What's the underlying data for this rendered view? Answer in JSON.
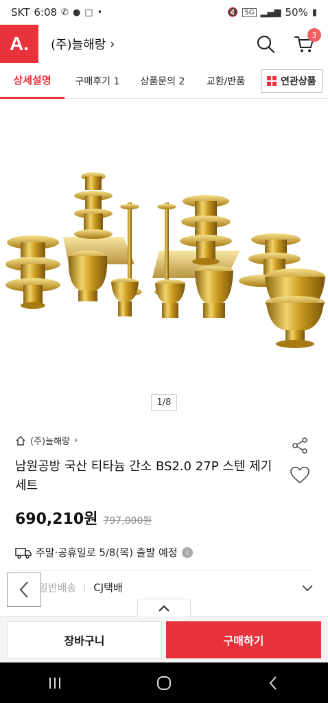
{
  "status_bar": {
    "carrier": "SKT",
    "time": "6:08",
    "network": "5G",
    "battery": "50%"
  },
  "header": {
    "logo": "A.",
    "store_name": "(주)늘해랑",
    "cart_count": "3"
  },
  "tabs": [
    {
      "label": "상세설명"
    },
    {
      "label": "구매후기 1"
    },
    {
      "label": "상품문의 2"
    },
    {
      "label": "교환/반품"
    },
    {
      "label": "연관상품"
    }
  ],
  "image": {
    "counter": "1/8"
  },
  "product": {
    "store_breadcrumb": "(주)늘해랑",
    "title": "남원공방 국산 티타늄 간소 BS2.0 27P 스텐 제기 세트",
    "price": "690,210원",
    "original_price": "797,000원",
    "delivery_text": "주말·공휴일로 5/8(목) 출발 예정",
    "shipping_label": "일반배송",
    "shipping_carrier": "CJ택배"
  },
  "actions": {
    "cart_label": "장바구니",
    "buy_label": "구매하기"
  },
  "colors": {
    "brand": "#e8333c",
    "badge": "#f0605e",
    "gold": "#d4a418"
  }
}
